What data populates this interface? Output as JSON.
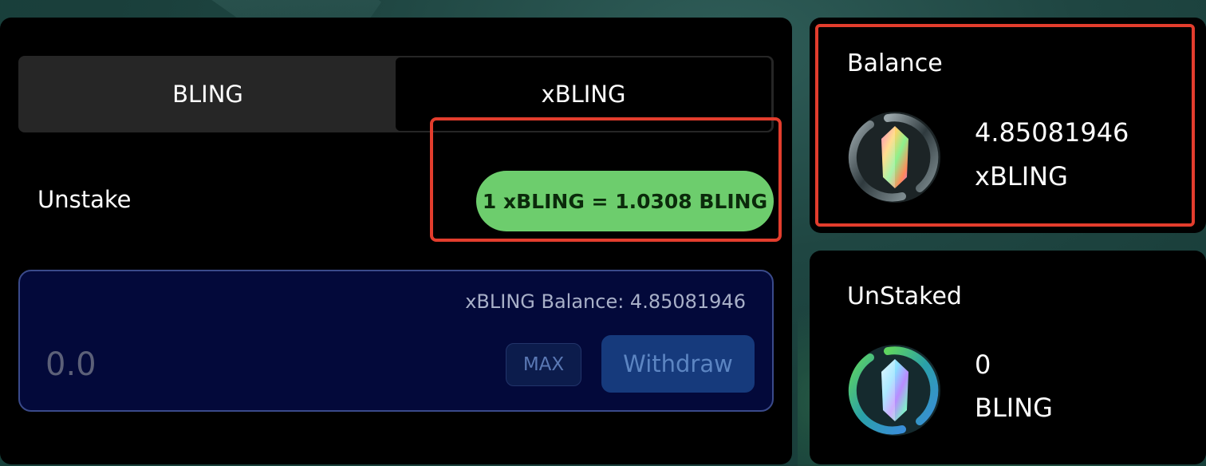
{
  "tabs": [
    {
      "label": "BLING",
      "active": false
    },
    {
      "label": "xBLING",
      "active": true
    }
  ],
  "unstake": {
    "label": "Unstake",
    "rate": "1 xBLING = 1.0308 BLING"
  },
  "input": {
    "balance_label": "xBLING Balance: 4.85081946",
    "placeholder": "0.0",
    "max_label": "MAX",
    "withdraw_label": "Withdraw"
  },
  "balance_card": {
    "title": "Balance",
    "amount": "4.85081946",
    "symbol": "xBLING",
    "icon": "xbling-token-icon"
  },
  "unstaked_card": {
    "title": "UnStaked",
    "amount": "0",
    "symbol": "BLING",
    "icon": "bling-token-icon"
  },
  "colors": {
    "accent_green": "#6dcd6d",
    "highlight_red": "#e33d2d",
    "input_bg": "#03093a",
    "withdraw_bg": "#163a7c"
  }
}
